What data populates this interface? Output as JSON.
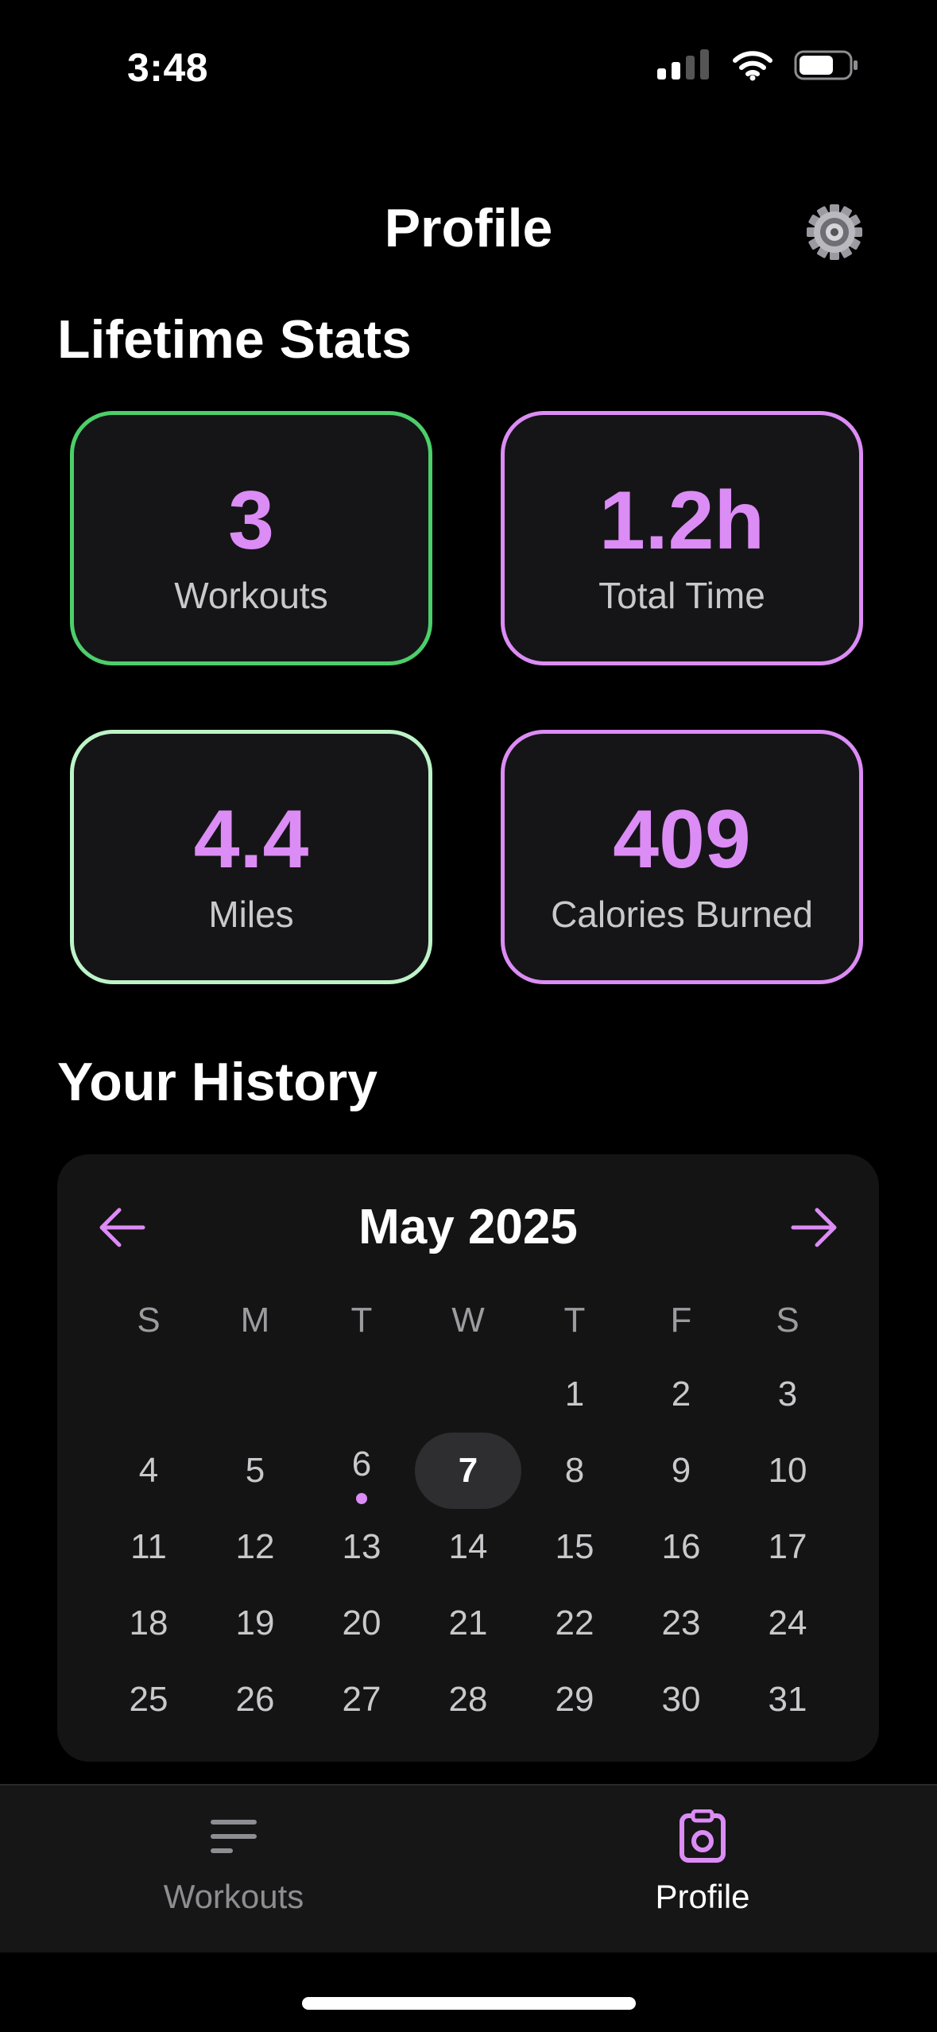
{
  "status_bar": {
    "time": "3:48",
    "battery_level": 0.7
  },
  "header": {
    "title": "Profile",
    "settings_icon": "gear-icon"
  },
  "lifetime_stats": {
    "title": "Lifetime Stats",
    "cards": [
      {
        "value": "3",
        "label": "Workouts",
        "border_color": "#4ccf6a"
      },
      {
        "value": "1.2h",
        "label": "Total Time",
        "border_color": "#dc8cf5"
      },
      {
        "value": "4.4",
        "label": "Miles",
        "border_color": "#bdf3c8"
      },
      {
        "value": "409",
        "label": "Calories Burned",
        "border_color": "#dc8cf5"
      }
    ]
  },
  "history": {
    "title": "Your History",
    "calendar": {
      "month_label": "May 2025",
      "prev_icon": "arrow-left-icon",
      "next_icon": "arrow-right-icon",
      "weekdays": [
        "S",
        "M",
        "T",
        "W",
        "T",
        "F",
        "S"
      ],
      "first_weekday_index": 4,
      "days": [
        "1",
        "2",
        "3",
        "4",
        "5",
        "6",
        "7",
        "8",
        "9",
        "10",
        "11",
        "12",
        "13",
        "14",
        "15",
        "16",
        "17",
        "18",
        "19",
        "20",
        "21",
        "22",
        "23",
        "24",
        "25",
        "26",
        "27",
        "28",
        "29",
        "30",
        "31"
      ],
      "selected_day": "7",
      "workout_days": [
        "6"
      ]
    }
  },
  "tab_bar": {
    "tabs": [
      {
        "label": "Workouts",
        "icon": "list-icon",
        "active": false
      },
      {
        "label": "Profile",
        "icon": "clipboard-icon",
        "active": true
      }
    ]
  },
  "colors": {
    "accent": "#dc8cf5",
    "background": "#000000",
    "card": "#151517",
    "green": "#4ccf6a",
    "mint": "#bdf3c8"
  }
}
